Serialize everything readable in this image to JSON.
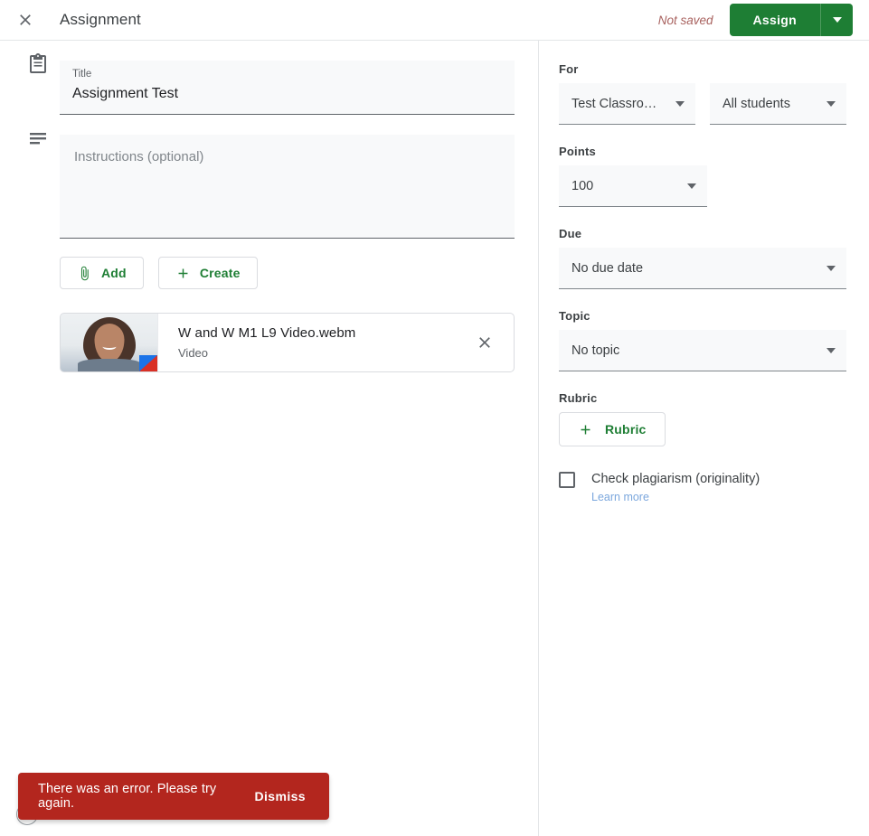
{
  "header": {
    "close_icon": "close-icon",
    "title": "Assignment",
    "save_status": "Not saved",
    "assign_label": "Assign",
    "assign_caret_icon": "chevron-down-icon",
    "accent_green": "#1e7e34",
    "not_saved_color": "#a8615e"
  },
  "form": {
    "title_icon": "clipboard-icon",
    "title_label": "Title",
    "title_value": "Assignment Test",
    "instructions_icon": "text-lines-icon",
    "instructions_placeholder": "Instructions (optional)",
    "instructions_value": "",
    "add_label": "Add",
    "add_icon": "paperclip-icon",
    "create_label": "Create",
    "create_icon": "plus-icon"
  },
  "attachment": {
    "name": "W and W M1 L9 Video.webm",
    "type": "Video",
    "thumbnail_icon": "video-thumbnail",
    "remove_icon": "close-icon"
  },
  "sidebar": {
    "for_label": "For",
    "class_value": "Test Classro…",
    "students_value": "All students",
    "points_label": "Points",
    "points_value": "100",
    "due_label": "Due",
    "due_value": "No due date",
    "topic_label": "Topic",
    "topic_value": "No topic",
    "rubric_label": "Rubric",
    "rubric_button_label": "Rubric",
    "rubric_button_icon": "plus-icon",
    "plagiarism_label": "Check plagiarism (originality)",
    "plagiarism_checked": false,
    "learn_more_label": "Learn more",
    "learn_more_color": "#7ba7dd"
  },
  "help": {
    "icon": "help-question-icon",
    "glyph": "?"
  },
  "snackbar": {
    "message": "There was an error. Please try again.",
    "action_label": "Dismiss",
    "background": "#b3261e"
  }
}
